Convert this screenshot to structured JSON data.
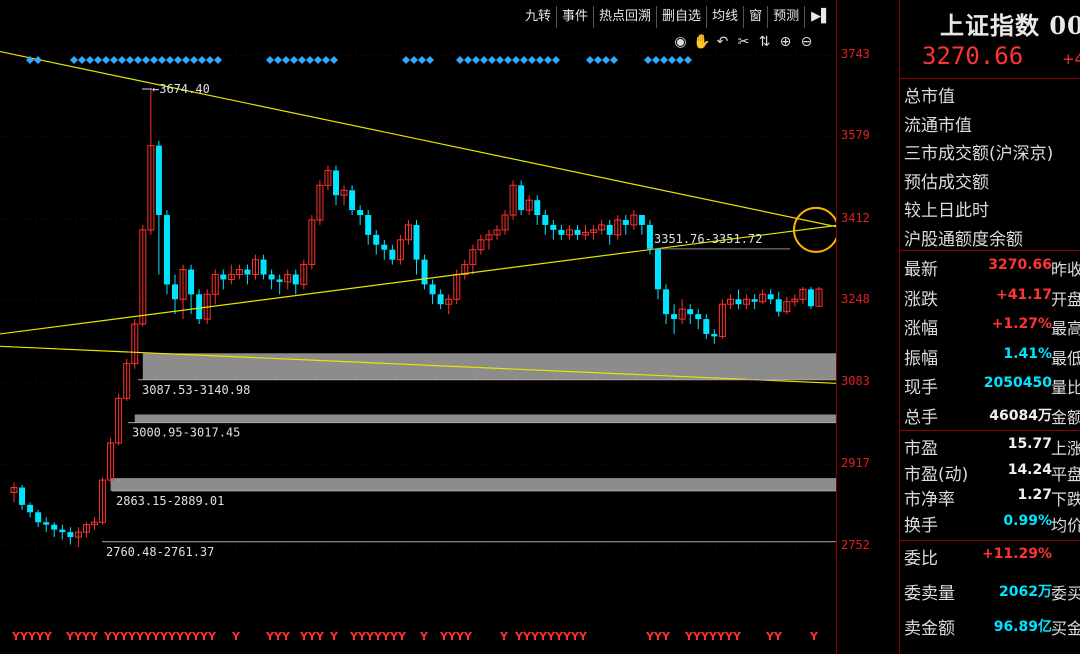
{
  "toolbar": {
    "buttons": [
      "九转",
      "事件",
      "热点回溯",
      "删自选",
      "均线",
      "窗",
      "预测"
    ],
    "arrow": "▶▌"
  },
  "tool_icons": [
    "eye-icon",
    "hand-icon",
    "undo-icon",
    "cut-icon",
    "move-icon",
    "zoom-in-icon",
    "zoom-out-icon"
  ],
  "price_axis": {
    "ticks": [
      {
        "value": 3743,
        "label": "3743"
      },
      {
        "value": 3579,
        "label": "3579"
      },
      {
        "value": 3412,
        "label": "3412"
      },
      {
        "value": 3248,
        "label": "3248"
      },
      {
        "value": 3083,
        "label": "3083"
      },
      {
        "value": 2917,
        "label": "2917"
      },
      {
        "value": 2752,
        "label": "2752"
      }
    ],
    "color": "#e02020"
  },
  "chart_data": {
    "type": "candlestick",
    "up_color": "#ff3030",
    "down_color": "#00e5ff",
    "candles": [
      [
        2860,
        2870,
        2840,
        2880
      ],
      [
        2870,
        2835,
        2825,
        2875
      ],
      [
        2835,
        2820,
        2810,
        2840
      ],
      [
        2820,
        2800,
        2790,
        2825
      ],
      [
        2800,
        2795,
        2780,
        2810
      ],
      [
        2795,
        2785,
        2770,
        2800
      ],
      [
        2785,
        2780,
        2765,
        2795
      ],
      [
        2780,
        2770,
        2755,
        2790
      ],
      [
        2770,
        2780,
        2750,
        2790
      ],
      [
        2780,
        2795,
        2770,
        2800
      ],
      [
        2795,
        2800,
        2785,
        2810
      ],
      [
        2800,
        2885,
        2795,
        2890
      ],
      [
        2885,
        2960,
        2880,
        2970
      ],
      [
        2960,
        3050,
        2955,
        3060
      ],
      [
        3050,
        3120,
        3045,
        3130
      ],
      [
        3120,
        3200,
        3110,
        3210
      ],
      [
        3200,
        3390,
        3195,
        3400
      ],
      [
        3390,
        3560,
        3380,
        3674.4
      ],
      [
        3560,
        3420,
        3300,
        3570
      ],
      [
        3420,
        3280,
        3260,
        3430
      ],
      [
        3280,
        3250,
        3220,
        3300
      ],
      [
        3250,
        3310,
        3210,
        3320
      ],
      [
        3310,
        3260,
        3220,
        3320
      ],
      [
        3260,
        3210,
        3200,
        3270
      ],
      [
        3210,
        3260,
        3200,
        3270
      ],
      [
        3260,
        3300,
        3240,
        3310
      ],
      [
        3300,
        3290,
        3270,
        3310
      ],
      [
        3290,
        3300,
        3280,
        3320
      ],
      [
        3300,
        3310,
        3290,
        3320
      ],
      [
        3310,
        3300,
        3280,
        3320
      ],
      [
        3300,
        3330,
        3290,
        3340
      ],
      [
        3330,
        3300,
        3290,
        3340
      ],
      [
        3300,
        3290,
        3270,
        3310
      ],
      [
        3290,
        3285,
        3260,
        3300
      ],
      [
        3285,
        3300,
        3270,
        3310
      ],
      [
        3300,
        3280,
        3260,
        3310
      ],
      [
        3280,
        3320,
        3270,
        3330
      ],
      [
        3320,
        3410,
        3310,
        3420
      ],
      [
        3410,
        3480,
        3400,
        3490
      ],
      [
        3480,
        3510,
        3470,
        3520
      ],
      [
        3510,
        3460,
        3440,
        3520
      ],
      [
        3460,
        3470,
        3440,
        3480
      ],
      [
        3470,
        3430,
        3420,
        3480
      ],
      [
        3430,
        3420,
        3400,
        3440
      ],
      [
        3420,
        3380,
        3360,
        3430
      ],
      [
        3380,
        3360,
        3340,
        3390
      ],
      [
        3360,
        3350,
        3330,
        3370
      ],
      [
        3350,
        3330,
        3320,
        3360
      ],
      [
        3330,
        3370,
        3320,
        3380
      ],
      [
        3370,
        3400,
        3360,
        3410
      ],
      [
        3400,
        3330,
        3300,
        3410
      ],
      [
        3330,
        3280,
        3270,
        3340
      ],
      [
        3280,
        3260,
        3240,
        3290
      ],
      [
        3260,
        3240,
        3230,
        3270
      ],
      [
        3240,
        3250,
        3220,
        3260
      ],
      [
        3250,
        3300,
        3240,
        3310
      ],
      [
        3300,
        3320,
        3290,
        3330
      ],
      [
        3320,
        3350,
        3300,
        3360
      ],
      [
        3350,
        3370,
        3340,
        3380
      ],
      [
        3370,
        3380,
        3350,
        3390
      ],
      [
        3380,
        3390,
        3370,
        3400
      ],
      [
        3390,
        3420,
        3380,
        3430
      ],
      [
        3420,
        3480,
        3410,
        3490
      ],
      [
        3480,
        3430,
        3420,
        3490
      ],
      [
        3430,
        3450,
        3420,
        3460
      ],
      [
        3450,
        3420,
        3400,
        3460
      ],
      [
        3420,
        3400,
        3380,
        3430
      ],
      [
        3400,
        3390,
        3370,
        3410
      ],
      [
        3390,
        3380,
        3370,
        3400
      ],
      [
        3380,
        3390,
        3370,
        3400
      ],
      [
        3390,
        3380,
        3370,
        3400
      ],
      [
        3380,
        3385,
        3370,
        3400
      ],
      [
        3385,
        3390,
        3370,
        3400
      ],
      [
        3390,
        3400,
        3380,
        3410
      ],
      [
        3400,
        3380,
        3360,
        3410
      ],
      [
        3380,
        3410,
        3370,
        3420
      ],
      [
        3410,
        3400,
        3380,
        3420
      ],
      [
        3400,
        3420,
        3390,
        3430
      ],
      [
        3420,
        3400,
        3380,
        3420
      ],
      [
        3400,
        3351.76,
        3340,
        3410
      ],
      [
        3351.76,
        3270,
        3250,
        3351.72
      ],
      [
        3270,
        3220,
        3200,
        3280
      ],
      [
        3220,
        3210,
        3180,
        3240
      ],
      [
        3210,
        3230,
        3200,
        3250
      ],
      [
        3230,
        3220,
        3200,
        3240
      ],
      [
        3220,
        3210,
        3190,
        3230
      ],
      [
        3210,
        3180,
        3170,
        3220
      ],
      [
        3180,
        3175,
        3160,
        3190
      ],
      [
        3175,
        3240,
        3170,
        3250
      ],
      [
        3240,
        3250,
        3230,
        3260
      ],
      [
        3250,
        3240,
        3230,
        3270
      ],
      [
        3240,
        3250,
        3230,
        3260
      ],
      [
        3250,
        3245,
        3230,
        3260
      ],
      [
        3245,
        3260,
        3240,
        3270
      ],
      [
        3260,
        3250,
        3240,
        3270
      ],
      [
        3250,
        3225,
        3215,
        3265
      ],
      [
        3225,
        3245,
        3220,
        3255
      ],
      [
        3245,
        3250,
        3235,
        3260
      ],
      [
        3250,
        3270,
        3240,
        3275
      ],
      [
        3270,
        3236,
        3230,
        3275
      ],
      [
        3236,
        3270.66,
        3235,
        3275
      ]
    ],
    "annotations": [
      {
        "text": "3674.40",
        "price": 3674.4
      },
      {
        "text": "3351.76-3351.72",
        "price": 3351.76
      },
      {
        "text": "3087.53-3140.98",
        "price": 3087.53
      },
      {
        "text": "3000.95-3017.45",
        "price": 3000.95
      },
      {
        "text": "2863.15-2889.01",
        "price": 2863.15
      },
      {
        "text": "2760.48-2761.37",
        "price": 2760.48
      }
    ],
    "gap_zones": [
      {
        "low": 3087.53,
        "high": 3140.98
      },
      {
        "low": 3000.95,
        "high": 3017.45
      },
      {
        "low": 2863.15,
        "high": 2889.01
      }
    ],
    "trend_lines": [
      {
        "from": [
          0,
          3750
        ],
        "to": [
          840,
          3395
        ]
      },
      {
        "from": [
          0,
          3180
        ],
        "to": [
          840,
          3400
        ]
      },
      {
        "from": [
          0,
          3155
        ],
        "to": [
          840,
          3080
        ]
      }
    ],
    "y_range": [
      2700,
      3790
    ],
    "y_marker": "Y"
  },
  "right_panel": {
    "title": "上证指数 00",
    "price": "3270.66",
    "change_partial": "+4",
    "top_labels": [
      "总市值",
      "流通市值",
      "三市成交额(沪深京)",
      "预估成交额",
      "较上日此时",
      "沪股通额度余额"
    ],
    "rows_block1": [
      {
        "label": "最新",
        "value": "3270.66",
        "color": "red",
        "label2": "昨收"
      },
      {
        "label": "涨跌",
        "value": "+41.17",
        "color": "red",
        "label2": "开盘"
      },
      {
        "label": "涨幅",
        "value": "+1.27%",
        "color": "red",
        "label2": "最高"
      },
      {
        "label": "振幅",
        "value": "1.41%",
        "color": "cyan",
        "label2": "最低"
      },
      {
        "label": "现手",
        "value": "2050450",
        "color": "cyan",
        "label2": "量比"
      },
      {
        "label": "总手",
        "value": "46084万",
        "color": "white",
        "label2": "金额"
      }
    ],
    "rows_block2": [
      {
        "label": "市盈",
        "value": "15.77",
        "color": "white",
        "label2": "上涨"
      },
      {
        "label": "市盈(动)",
        "value": "14.24",
        "color": "white",
        "label2": "平盘"
      },
      {
        "label": "市净率",
        "value": "1.27",
        "color": "white",
        "label2": "下跌"
      },
      {
        "label": "换手",
        "value": "0.99%",
        "color": "cyan",
        "label2": "均价"
      }
    ],
    "rows_block3": [
      {
        "label": "委比",
        "value": "+11.29%",
        "color": "red",
        "label2": ""
      },
      {
        "label": "委卖量",
        "value": "2062万",
        "color": "cyan",
        "label2": "委买"
      },
      {
        "label": "卖金额",
        "value": "96.89亿",
        "color": "cyan",
        "label2": "买金"
      }
    ]
  }
}
